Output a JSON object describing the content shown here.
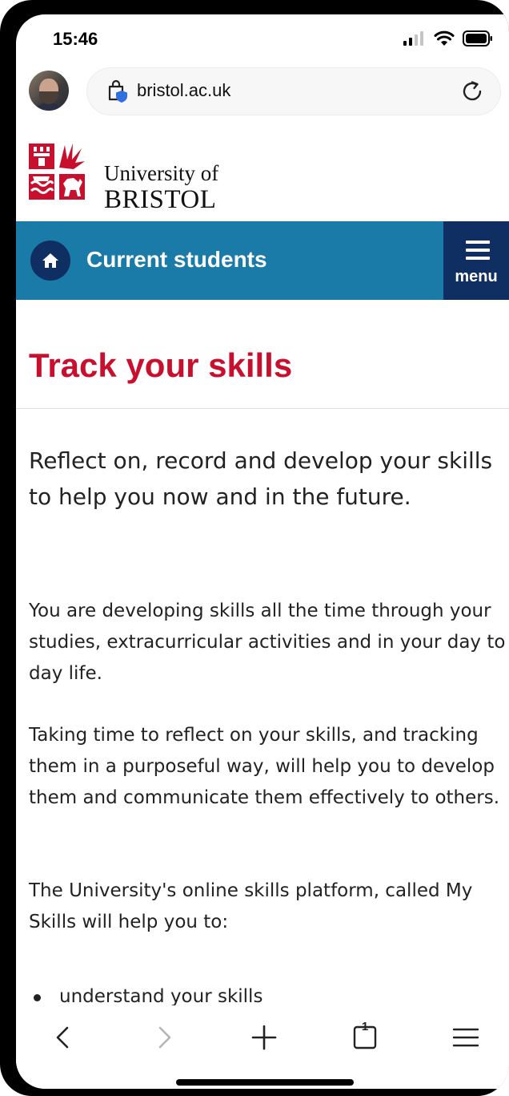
{
  "status": {
    "time": "15:46"
  },
  "browser": {
    "url": "bristol.ac.uk"
  },
  "logo": {
    "line1": "University of",
    "line2": "BRISTOL"
  },
  "nav": {
    "title": "Current students",
    "menu_label": "menu"
  },
  "page": {
    "title": "Track your skills",
    "lead": "Reflect on, record and develop your skills to help you now and in the future.",
    "paragraphs": [
      "You are developing skills all the time through your studies, extracurricular activities and in your day to day life.",
      "Taking time to reflect on your skills, and tracking them in a purposeful way, will help you to develop them and communicate them effectively to others.",
      "The University's online skills platform, called My Skills will help you to:"
    ],
    "bullets": [
      "understand your skills"
    ]
  },
  "toolbar": {
    "tab_count": "1"
  },
  "colors": {
    "brand_red": "#c8102e",
    "nav_blue": "#1a7aa8",
    "nav_dark": "#0f2f63"
  }
}
